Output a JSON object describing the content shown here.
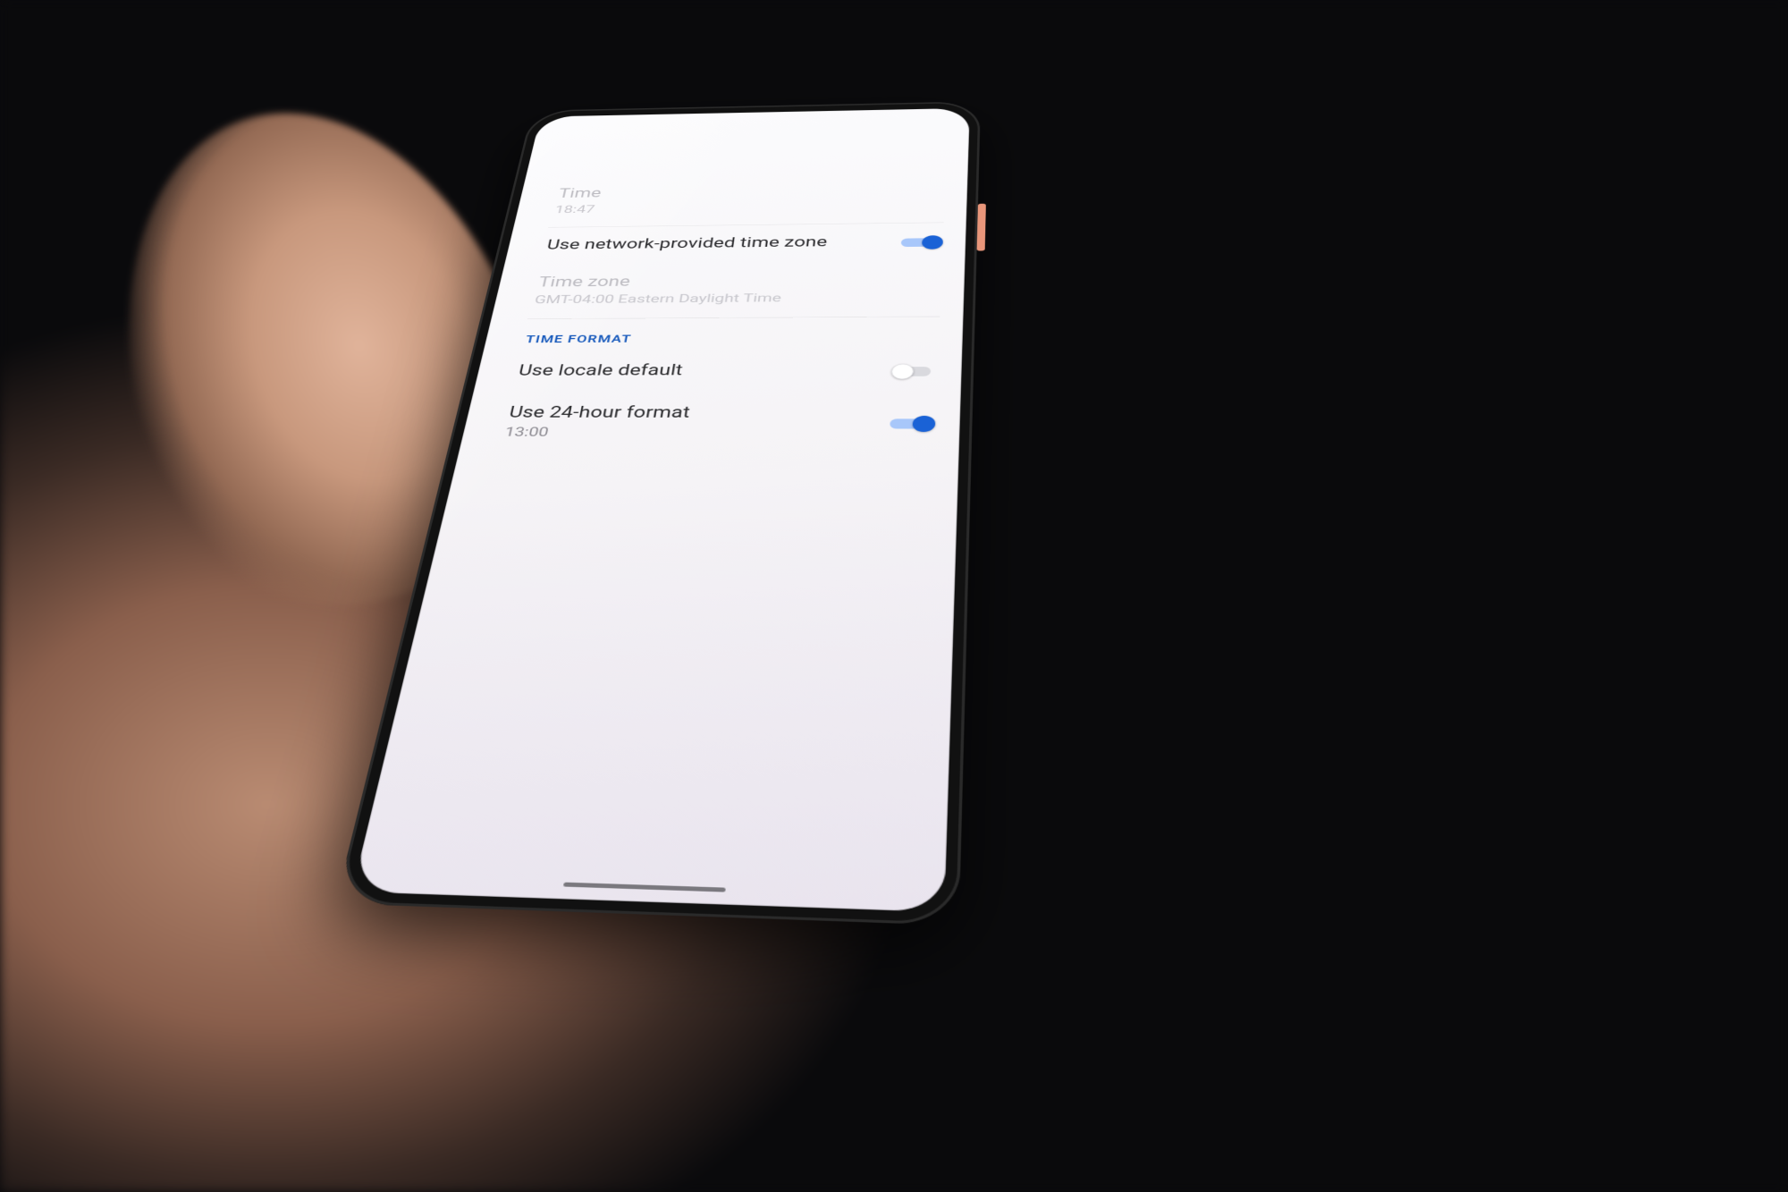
{
  "colors": {
    "accent": "#1a62d6",
    "section_header": "#185abc"
  },
  "rows": {
    "time": {
      "title": "Time",
      "value": "18:47"
    },
    "use_network_tz": {
      "title": "Use network-provided time zone",
      "enabled": true
    },
    "time_zone": {
      "title": "Time zone",
      "value": "GMT-04:00 Eastern Daylight Time"
    }
  },
  "section": {
    "time_format_header": "TIME FORMAT"
  },
  "format_rows": {
    "locale_default": {
      "title": "Use locale default",
      "enabled": false
    },
    "use_24h": {
      "title": "Use 24-hour format",
      "sub": "13:00",
      "enabled": true
    }
  }
}
